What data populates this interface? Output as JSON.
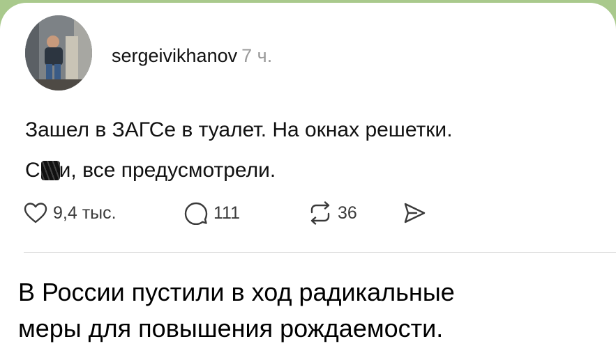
{
  "post": {
    "author": {
      "username": "sergeivikhanov",
      "time_ago": "7 ч."
    },
    "text": {
      "line1": "Зашел в ЗАГСе в туалет. На окнах решетки.",
      "line2_prefix": "С",
      "line2_suffix": "и, все предусмотрели."
    },
    "actions": {
      "likes": "9,4 тыс.",
      "comments": "111",
      "reposts": "36"
    },
    "icons": {
      "like": "heart-icon",
      "comment": "comment-bubble-icon",
      "repost": "repost-icon",
      "share": "send-icon"
    }
  },
  "caption": {
    "line1": "В России пустили в ход радикальные",
    "line2": "меры для повышения рождаемости."
  },
  "colors": {
    "outer_background": "#a9c98c",
    "card_background": "#ffffff",
    "text": "#111111",
    "muted_text": "#9a9a9a"
  }
}
